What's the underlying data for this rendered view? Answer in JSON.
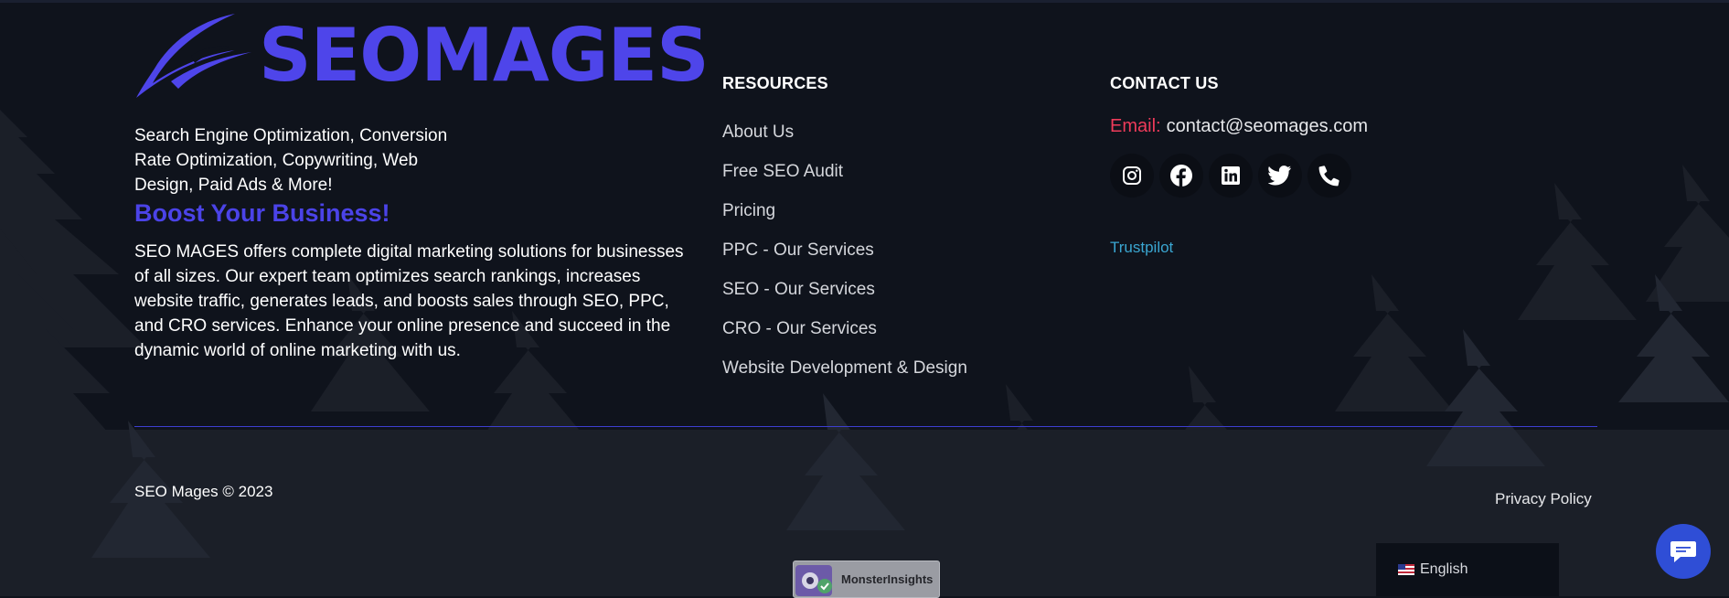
{
  "brand": {
    "name": "SEOMAGES"
  },
  "about": {
    "tagline": "Search Engine Optimization, Conversion Rate Optimization, Copywriting, Web Design, Paid Ads & More!",
    "headline": "Boost Your Business!",
    "description": "SEO MAGES offers complete digital marketing solutions for businesses of all sizes. Our expert team optimizes search rankings, increases website traffic, generates leads, and boosts sales through SEO, PPC, and CRO services. Enhance your online presence and succeed in the dynamic world of online marketing with us."
  },
  "resources": {
    "title": "RESOURCES",
    "links": [
      {
        "label": "About Us"
      },
      {
        "label": "Free SEO Audit"
      },
      {
        "label": "Pricing"
      },
      {
        "label": "PPC - Our Services"
      },
      {
        "label": "SEO - Our Services"
      },
      {
        "label": "CRO - Our Services"
      },
      {
        "label": "Website Development & Design"
      }
    ]
  },
  "contact": {
    "title": "CONTACT US",
    "email_label": "Email:",
    "email": "contact@seomages.com",
    "socials": [
      "instagram-icon",
      "facebook-icon",
      "linkedin-icon",
      "twitter-icon",
      "phone-icon"
    ],
    "trustpilot": "Trustpilot"
  },
  "footer": {
    "copyright": "SEO Mages © 2023",
    "privacy": "Privacy Policy"
  },
  "badges": {
    "monsterinsights": "MonsterInsights"
  },
  "language": {
    "selected": "English"
  },
  "colors": {
    "background": "#0f131c",
    "brand": "#4e45ea",
    "email_label": "#ee3b5a",
    "trustpilot": "#3aa6d1",
    "chat": "#2f4ed6"
  }
}
